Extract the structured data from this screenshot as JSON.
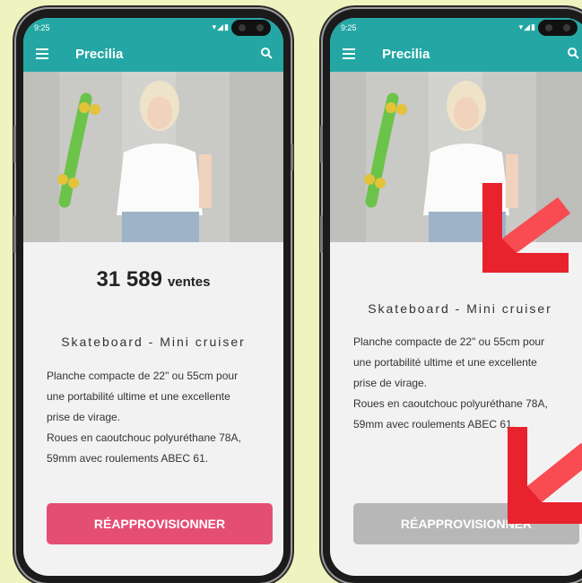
{
  "status": {
    "time": "9:25"
  },
  "app": {
    "title": "Precilia"
  },
  "product": {
    "sales_number": "31 589",
    "sales_unit": "ventes",
    "title": "Skateboard - Mini cruiser",
    "desc_line1": "Planche compacte de 22\" ou 55cm pour",
    "desc_line2": "une portabilité ultime et une excellente",
    "desc_line3": "prise de virage.",
    "desc_line4": "Roues en caoutchouc polyuréthane 78A,",
    "desc_line5": "59mm avec roulements ABEC 61.",
    "desc_line5_right": "59mm avec roulements ABEC 61."
  },
  "buttons": {
    "restock_label": "RÉAPPROVISIONNER"
  },
  "colors": {
    "teal": "#24a7a4",
    "pink_button": "#e54e73",
    "disabled_button": "#b7b7b7",
    "annotation_arrow": "#e8232e",
    "background": "#eef3bf"
  },
  "icons": [
    "menu-icon",
    "search-icon",
    "arrow-annotation-icon"
  ]
}
